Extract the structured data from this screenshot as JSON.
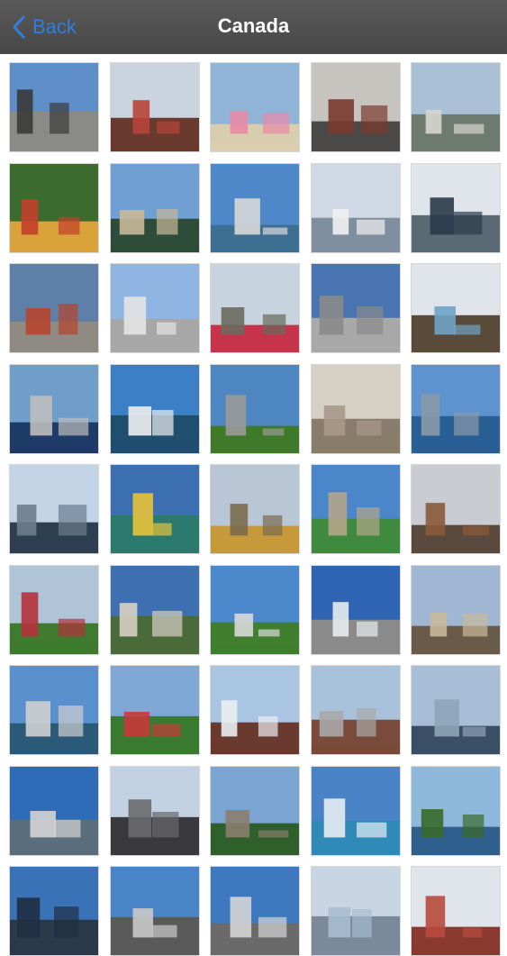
{
  "navbar": {
    "back_label": "Back",
    "title": "Canada"
  },
  "colors": {
    "navbar_bg": "#4d4d4d",
    "accent": "#2f7fe0",
    "title_text": "#ffffff"
  },
  "photos": [
    {
      "name": "airport",
      "sky": "#5f8fc8",
      "ground": "#8a8a86",
      "accent": "#3a3a3a"
    },
    {
      "name": "flatiron-building",
      "sky": "#c9d4df",
      "ground": "#6a3a2e",
      "accent": "#b8453a"
    },
    {
      "name": "beach-umbrellas",
      "sky": "#8fb4d8",
      "ground": "#d9cdb0",
      "accent": "#e98aa6"
    },
    {
      "name": "city-street",
      "sky": "#c7c4bf",
      "ground": "#4c4a48",
      "accent": "#7a3a2e"
    },
    {
      "name": "harbour-aerial",
      "sky": "#a9c0d6",
      "ground": "#6f7a6e",
      "accent": "#d6d6d0"
    },
    {
      "name": "flower-garden",
      "sky": "#3d6b2e",
      "ground": "#d9a23a",
      "accent": "#c2402b"
    },
    {
      "name": "waterfront-building",
      "sky": "#6f9fd3",
      "ground": "#2d4d3a",
      "accent": "#c8b898"
    },
    {
      "name": "cn-tower",
      "sky": "#4e88c9",
      "ground": "#3d6f92",
      "accent": "#d7d7d7"
    },
    {
      "name": "canada-place",
      "sky": "#cfd8e4",
      "ground": "#7f8fa0",
      "accent": "#f1f1f1"
    },
    {
      "name": "aviation-museum",
      "sky": "#dfe5ea",
      "ground": "#5a6a74",
      "accent": "#2a3a4a"
    },
    {
      "name": "modern-museum",
      "sky": "#5e7fa8",
      "ground": "#8f8a84",
      "accent": "#b7452e"
    },
    {
      "name": "white-church",
      "sky": "#8fb6e2",
      "ground": "#a7a7a7",
      "accent": "#e4e4e4"
    },
    {
      "name": "parliament-garden",
      "sky": "#c7d3de",
      "ground": "#c5344a",
      "accent": "#6a6a5e"
    },
    {
      "name": "city-hall",
      "sky": "#4874b2",
      "ground": "#a8a8a8",
      "accent": "#8a8a8a"
    },
    {
      "name": "glass-tower",
      "sky": "#dfe4ea",
      "ground": "#5a4a3a",
      "accent": "#6fa3c6"
    },
    {
      "name": "curved-bridge",
      "sky": "#6e9ec9",
      "ground": "#1e3a66",
      "accent": "#bdbdbd"
    },
    {
      "name": "cruise-ship",
      "sky": "#3b7fc4",
      "ground": "#1f4e6f",
      "accent": "#f0f0f0"
    },
    {
      "name": "green-road",
      "sky": "#4d86c1",
      "ground": "#3f7a2a",
      "accent": "#9a9a9a"
    },
    {
      "name": "horse-carriage",
      "sky": "#d6d0c4",
      "ground": "#8a7c6a",
      "accent": "#a8998a"
    },
    {
      "name": "lake-skyline",
      "sky": "#5f93cf",
      "ground": "#2a5f96",
      "accent": "#8a9aa8"
    },
    {
      "name": "downtown-towers",
      "sky": "#c3d4e6",
      "ground": "#2f3f52",
      "accent": "#6a7c8e"
    },
    {
      "name": "mountain-lake",
      "sky": "#3c6fb2",
      "ground": "#2b7a6e",
      "accent": "#e8c23a"
    },
    {
      "name": "parliament-fall",
      "sky": "#b8c6d6",
      "ground": "#c69a3a",
      "accent": "#7a6a4e"
    },
    {
      "name": "peace-tower",
      "sky": "#4a86c9",
      "ground": "#3f8a3f",
      "accent": "#b5a58a"
    },
    {
      "name": "city-dusk",
      "sky": "#c9ccd2",
      "ground": "#5a4a3e",
      "accent": "#8a5a3a"
    },
    {
      "name": "baseball-stadium",
      "sky": "#b0c4d8",
      "ground": "#3f7a2e",
      "accent": "#b5323a"
    },
    {
      "name": "chateau-town",
      "sky": "#3e6fb0",
      "ground": "#4a6a3a",
      "accent": "#d7d0c4"
    },
    {
      "name": "exhibition-park",
      "sky": "#4c88cc",
      "ground": "#3f7f2e",
      "accent": "#d9d9d9"
    },
    {
      "name": "curved-glass-building",
      "sky": "#2f64b2",
      "ground": "#8a8a8a",
      "accent": "#e8ecf0"
    },
    {
      "name": "old-building-towers",
      "sky": "#9fb7d2",
      "ground": "#6a5a4a",
      "accent": "#c9b89a"
    },
    {
      "name": "cn-tower-cityview",
      "sky": "#5a90cc",
      "ground": "#2a5a78",
      "accent": "#cfcfcf"
    },
    {
      "name": "garden-mansion",
      "sky": "#7fa8d6",
      "ground": "#3a7a2e",
      "accent": "#c73a3a"
    },
    {
      "name": "mountain-village",
      "sky": "#a9c5e2",
      "ground": "#6a3a2e",
      "accent": "#e9eef2"
    },
    {
      "name": "brick-houses",
      "sky": "#a8c2dc",
      "ground": "#7a4a3a",
      "accent": "#a8a8a8"
    },
    {
      "name": "marina-skyline",
      "sky": "#a8bed6",
      "ground": "#3a4f66",
      "accent": "#8ea4b8"
    },
    {
      "name": "harbor-city",
      "sky": "#2f6cb8",
      "ground": "#5a6e7e",
      "accent": "#d4d4d4"
    },
    {
      "name": "castle-gray",
      "sky": "#c2d2e2",
      "ground": "#3a3a3e",
      "accent": "#6a6a6e"
    },
    {
      "name": "chateau-hill",
      "sky": "#7aa4d2",
      "ground": "#2f5f2a",
      "accent": "#8a7e6e"
    },
    {
      "name": "rocky-mountains-lake",
      "sky": "#4a82c6",
      "ground": "#2f8ab8",
      "accent": "#e6edf3"
    },
    {
      "name": "coastal-tree",
      "sky": "#8fb8dd",
      "ground": "#2f5f8c",
      "accent": "#3a6a2a"
    },
    {
      "name": "tall-towers",
      "sky": "#3a72b8",
      "ground": "#2a3a4a",
      "accent": "#1f2f42"
    },
    {
      "name": "skyline-partial",
      "sky": "#4a84c8",
      "ground": "#5a5a5a",
      "accent": "#c9c9c9"
    },
    {
      "name": "dome-building",
      "sky": "#3e78be",
      "ground": "#6a6a6a",
      "accent": "#d4d4d4"
    },
    {
      "name": "highrise-glass",
      "sky": "#c8d6e4",
      "ground": "#7a8a9a",
      "accent": "#a8bcd0"
    },
    {
      "name": "red-brick-tower",
      "sky": "#dfe5ea",
      "ground": "#8a3a2e",
      "accent": "#b84a3e"
    }
  ]
}
